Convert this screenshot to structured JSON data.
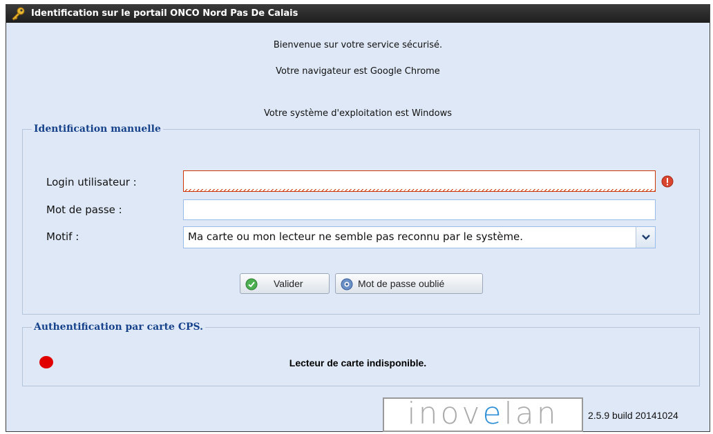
{
  "window": {
    "title": "Identification sur le portail ONCO Nord Pas De Calais",
    "icon": "key-icon"
  },
  "welcome": {
    "line1": "Bienvenue sur votre service sécurisé.",
    "line2": "Votre navigateur est Google Chrome",
    "line3": "Votre système d'exploitation est Windows"
  },
  "manual": {
    "legend": "Identification manuelle",
    "login_label": "Login utilisateur :",
    "login_value": "",
    "password_label": "Mot de passe :",
    "password_value": "",
    "reason_label": "Motif :",
    "reason_value": "Ma carte ou mon lecteur ne semble pas reconnu par le système.",
    "validate_label": "Valider",
    "forgot_label": "Mot de passe oublié"
  },
  "cps": {
    "legend": "Authentification par carte CPS.",
    "status_text": "Lecteur de carte indisponible.",
    "status_color": "#e00000"
  },
  "footer": {
    "logo_text_1": "inov",
    "logo_text_2": "e",
    "logo_text_3": "lan",
    "version": "2.5.9 build 20141024"
  },
  "colors": {
    "titlebar": "#1e1e1e",
    "panel_bg": "#dfe8f6",
    "legend": "#15428b",
    "error": "#cc3300"
  }
}
